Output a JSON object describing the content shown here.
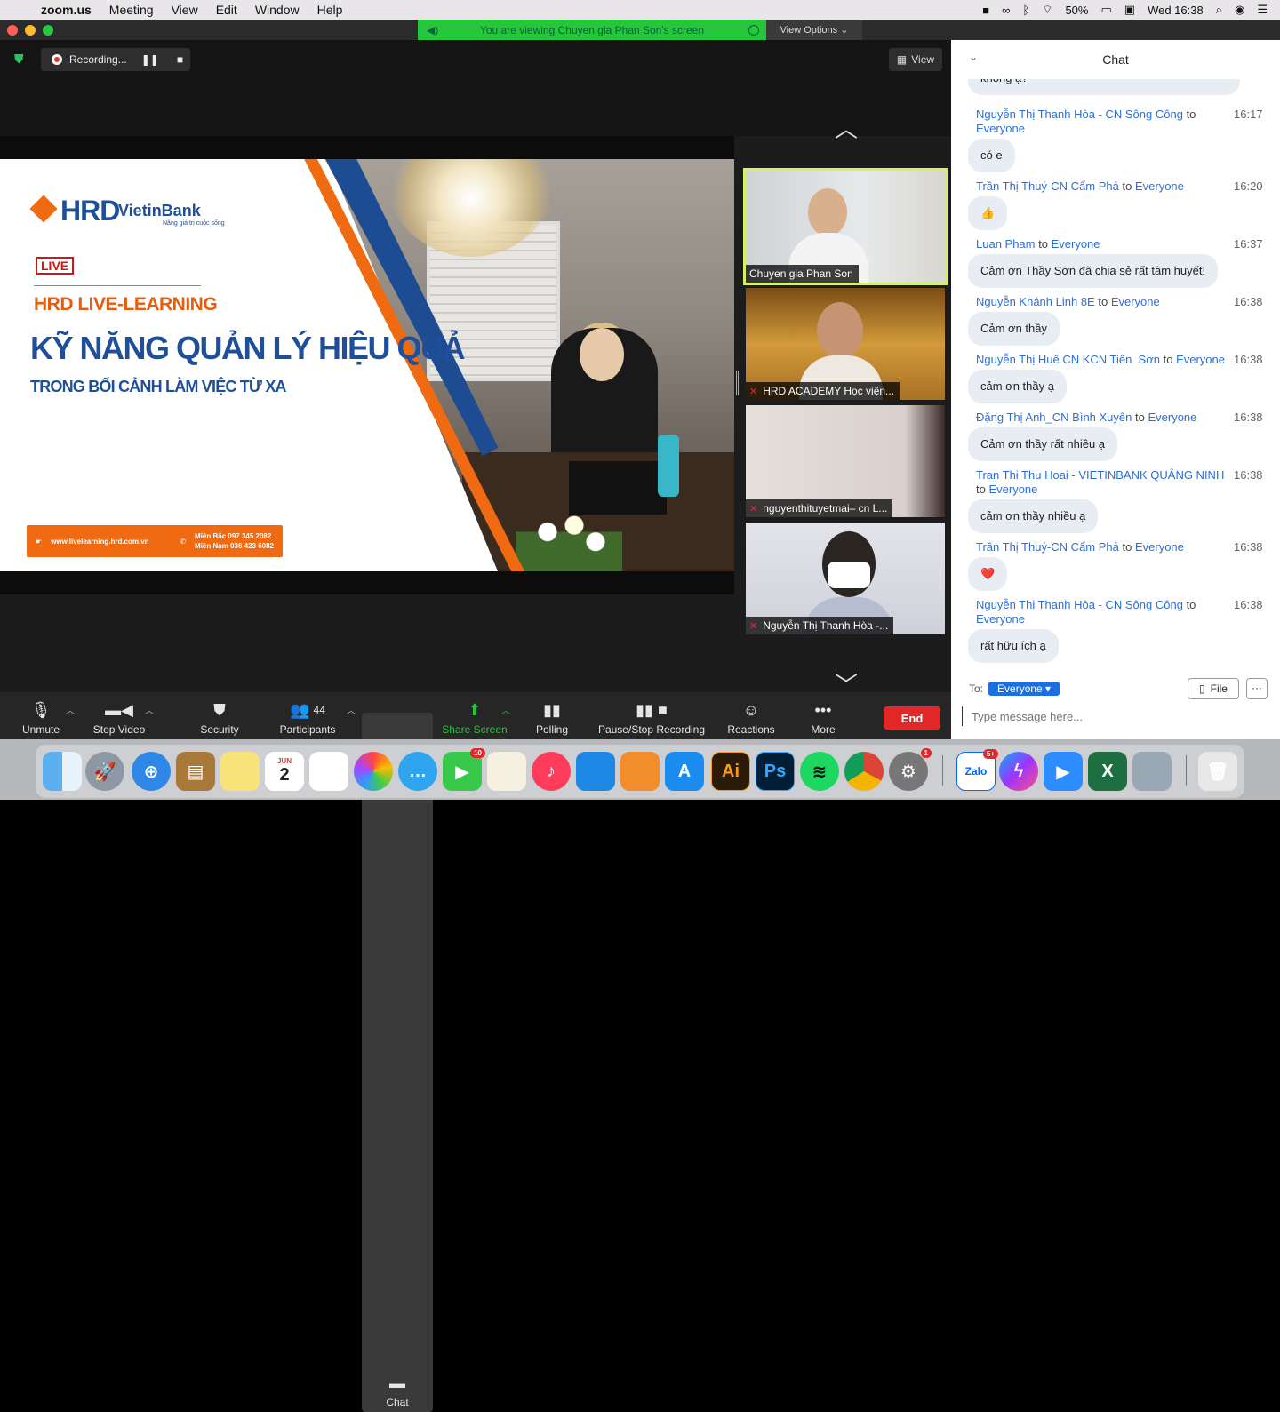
{
  "menubar": {
    "app": "zoom.us",
    "items": [
      "Meeting",
      "View",
      "Edit",
      "Window",
      "Help"
    ],
    "battery": "50%",
    "clock": "Wed 16:38"
  },
  "window": {
    "viewing_banner": "You are viewing Chuyen gia Phan Son's screen",
    "view_options": "View Options ⌄",
    "recording_label": "Recording...",
    "view_button": "View"
  },
  "slide": {
    "hrd_logo": "HRD",
    "vietinbank_logo": "VietinBank",
    "vietinbank_slogan": "Nâng giá trị cuộc sống",
    "live_badge": "LIVE",
    "title_small": "HRD LIVE-LEARNING",
    "title_main": "KỸ NĂNG QUẢN LÝ HIỆU QUẢ",
    "title_sub": "TRONG BỐI CẢNH LÀM VIỆC TỪ XA",
    "website": "www.livelearning.hrd.com.vn",
    "phone_north": "Miền Bắc 097 345 2082",
    "phone_south": "Miền Nam 036 423 6082"
  },
  "participants_video": [
    {
      "name": "Chuyen gia Phan Son",
      "muted": false
    },
    {
      "name": "HRD ACADEMY Học viện...",
      "muted": true
    },
    {
      "name": "nguyenthituyetmai– cn L...",
      "muted": true
    },
    {
      "name": "Nguyễn Thị Thanh Hòa -...",
      "muted": true
    }
  ],
  "toolbar": {
    "unmute": "Unmute",
    "stop_video": "Stop Video",
    "security": "Security",
    "participants": "Participants",
    "participants_count": "44",
    "chat": "Chat",
    "share_screen": "Share Screen",
    "polling": "Polling",
    "pause_recording": "Pause/Stop Recording",
    "reactions": "Reactions",
    "more": "More",
    "end": "End"
  },
  "chat": {
    "title": "Chat",
    "first_partial": "không ạ?",
    "messages": [
      {
        "sender": "Nguyễn Thị Thanh Hòa - CN Sông Công",
        "to": "to",
        "target": "Everyone",
        "time": "16:17",
        "text": "có e"
      },
      {
        "sender": "Trần Thị Thuý-CN Cẩm Phả",
        "to": "to",
        "target": "Everyone",
        "time": "16:20",
        "text": "👍"
      },
      {
        "sender": "Luan Pham",
        "to": "to",
        "target": "Everyone",
        "time": "16:37",
        "text": "Cảm ơn Thầy Sơn đã chia sẻ rất tâm huyết!"
      },
      {
        "sender": "Nguyễn Khánh Linh 8E",
        "to": "to",
        "target": "Everyone",
        "time": "16:38",
        "text": "Cảm ơn thầy"
      },
      {
        "sender": "Nguyễn Thị Huế CN KCN Tiên  Sơn",
        "to": "to",
        "target": "Everyone",
        "time": "16:38",
        "text": "cảm ơn thầy ạ"
      },
      {
        "sender": "Đặng Thị Anh_CN Bình Xuyên",
        "to": "to",
        "target": "Everyone",
        "time": "16:38",
        "text": "Cảm ơn thầy rất nhiều ạ"
      },
      {
        "sender": "Tran Thi Thu Hoai - VIETINBANK QUẢNG NINH",
        "to": "to",
        "target": "Everyone",
        "time": "16:38",
        "text": "cảm ơn thầy nhiều ạ"
      },
      {
        "sender": "Trần Thị Thuý-CN Cẩm Phả",
        "to": "to",
        "target": "Everyone",
        "time": "16:38",
        "text": "❤️"
      },
      {
        "sender": "Nguyễn Thị Thanh Hòa - CN Sông Công",
        "to": "to",
        "target": "Everyone",
        "time": "16:38",
        "text": "rất hữu ích ạ"
      }
    ],
    "to_label": "To:",
    "to_value": "Everyone",
    "file_button": "File",
    "more_button": "···",
    "input_placeholder": "Type message here..."
  },
  "dock": {
    "calendar_month": "JUN",
    "calendar_day": "2",
    "facetime_badge": "10",
    "settings_badge": "1",
    "zalo_badge": "5+",
    "zalo_label": "Zalo",
    "ai_label": "Ai",
    "ps_label": "Ps"
  }
}
